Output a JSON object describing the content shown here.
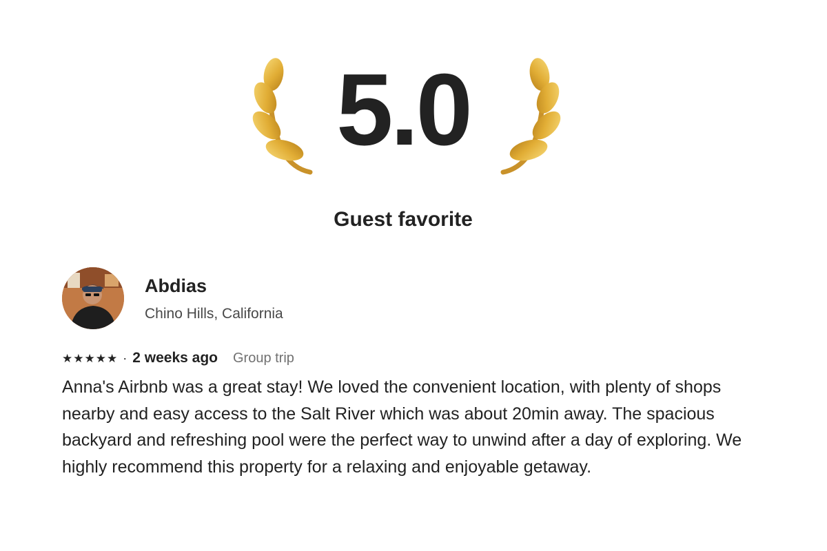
{
  "rating": {
    "value": "5.0",
    "badge": "Guest favorite"
  },
  "reviewer": {
    "name": "Abdias",
    "location": "Chino Hills, California",
    "avatar_icon": "reviewer-photo"
  },
  "review": {
    "stars": 5,
    "star_icon": "star-icon",
    "separator": "·",
    "date": "2 weeks ago",
    "trip_type": "Group trip",
    "text": "Anna's Airbnb was a great stay! We loved the convenient location, with plenty of shops nearby and easy access to the Salt River which was about 20min away. The spacious backyard and refreshing pool were the perfect way to unwind after a day of exploring. We highly recommend this property for a relaxing and enjoyable getaway."
  },
  "colors": {
    "text": "#222222",
    "muted": "#717171",
    "laurel_gold": "#e3b23c"
  }
}
